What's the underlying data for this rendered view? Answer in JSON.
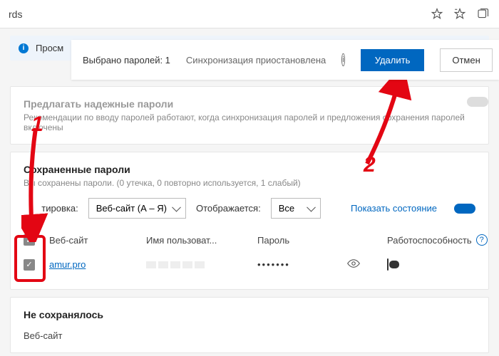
{
  "addr": {
    "fragment": "rds"
  },
  "info_strip": {
    "text": "Просм"
  },
  "action_bar": {
    "selected_label": "Выбрано паролей: 1",
    "sync_label": "Синхронизация приостановлена",
    "delete_label": "Удалить",
    "cancel_label": "Отмен"
  },
  "suggest": {
    "title": "Предлагать надежные пароли",
    "sub": "Рекомендации по вводу паролей работают, когда синхронизация паролей и предложения сохранения паролей включены"
  },
  "saved": {
    "title": "Сохраненные пароли",
    "summary": "Вы    сохранены пароли. (0 утечка, 0 повторно используется, 1 слабый)",
    "sort_label": "       тировка:",
    "sort_value": "Веб-сайт (А – Я)",
    "show_label": "Отображается:",
    "show_value": "Все",
    "status_link": "Показать состояние",
    "cols": {
      "site": "Веб-сайт",
      "user": "Имя пользоват...",
      "pass": "Пароль",
      "health": "Работоспособность"
    },
    "row": {
      "site": "amur.pro",
      "pass_mask": "•••••••"
    }
  },
  "never": {
    "title": "Не сохранялось",
    "col_site": "Веб-сайт"
  },
  "anno": {
    "one": "1",
    "two": "2"
  }
}
